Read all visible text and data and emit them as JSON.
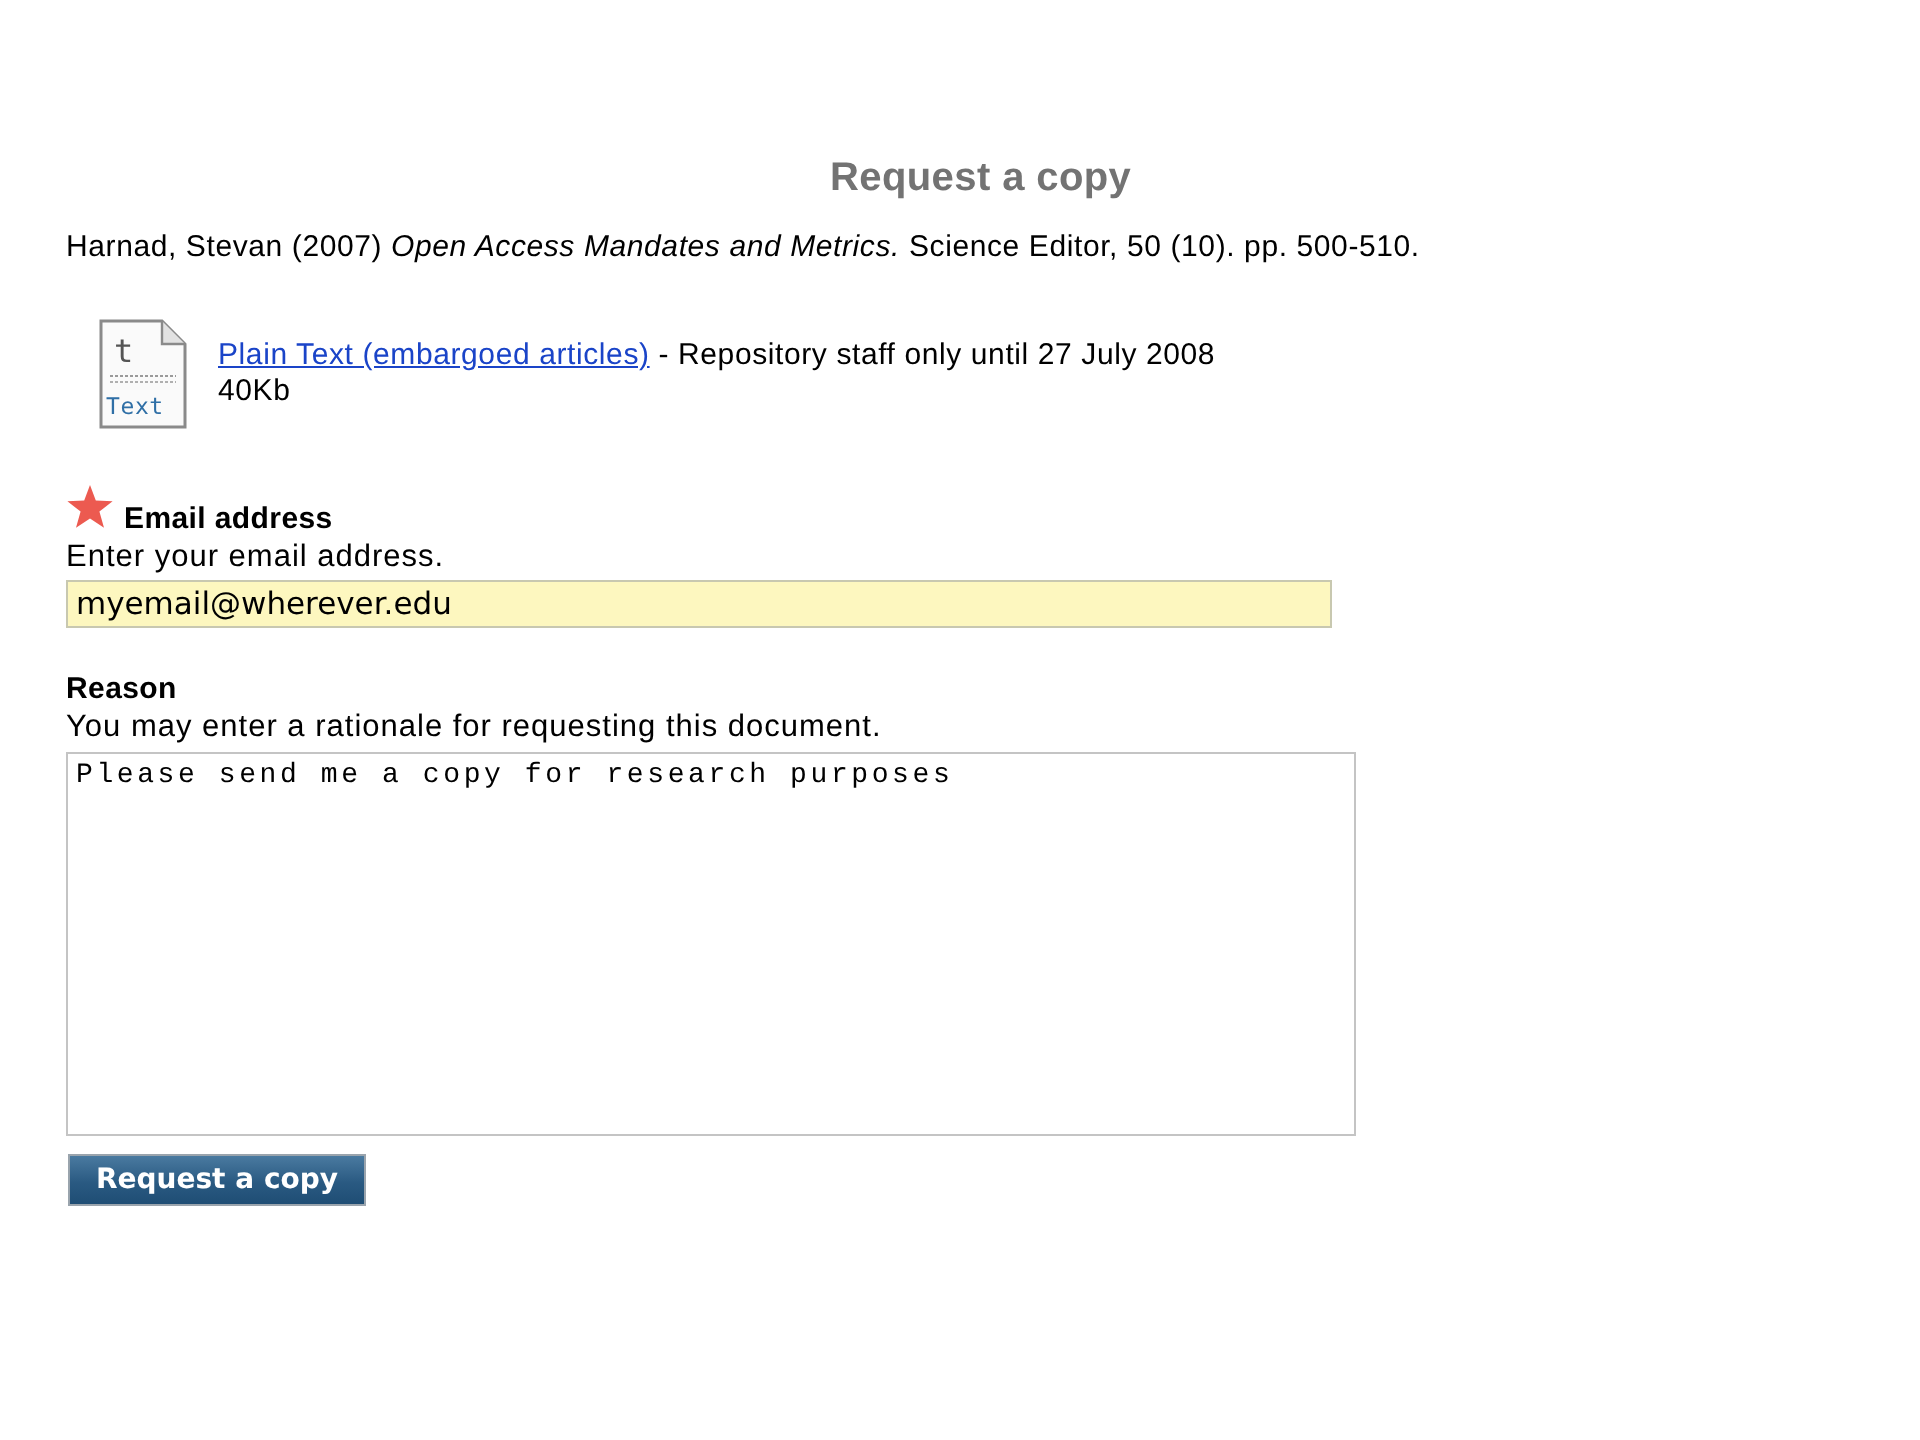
{
  "title": "Request a copy",
  "citation": "Harnad, Stevan (2007) *Open Access Mandates and Metrics.* Science Editor, 50 (10). pp. 500-510.",
  "document": {
    "icon_letter": "t",
    "icon_label": "Text",
    "link": "Plain Text (embargoed articles)",
    "note": "- Repository staff only until 27 July 2008",
    "size": "40Kb"
  },
  "fields": [
    {
      "kind": "input",
      "label": "Email address",
      "required": true,
      "help": "Enter your email address.",
      "value": "myemail@wherever.edu"
    },
    {
      "kind": "textarea",
      "label": "Reason",
      "required": false,
      "help": "You may enter a rationale for requesting this document.",
      "value": "Please send me a copy for research purposes"
    }
  ],
  "submit": "Request a copy"
}
